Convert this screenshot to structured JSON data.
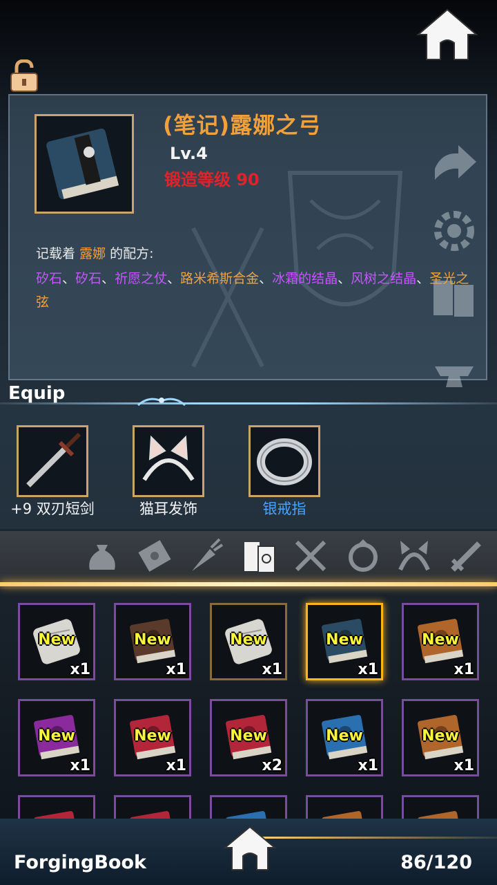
{
  "item": {
    "title": "(笔记)露娜之弓",
    "level": "Lv.4",
    "forge_label": "锻造等级",
    "forge_value": "90"
  },
  "recipe": {
    "prefix": "记载着",
    "name": "露娜",
    "suffix": "的配方:",
    "materials": [
      {
        "text": "矽石",
        "color": "purple"
      },
      {
        "text": "、",
        "color": "white"
      },
      {
        "text": "矽石",
        "color": "purple"
      },
      {
        "text": "、",
        "color": "white"
      },
      {
        "text": "祈愿之仗",
        "color": "purple"
      },
      {
        "text": "、",
        "color": "white"
      },
      {
        "text": "路米希斯合金",
        "color": "orange"
      },
      {
        "text": "、",
        "color": "white"
      },
      {
        "text": "冰霜的结晶",
        "color": "purple"
      },
      {
        "text": "、",
        "color": "white"
      },
      {
        "text": "风树之结晶",
        "color": "purple"
      },
      {
        "text": "、",
        "color": "white"
      },
      {
        "text": "圣光之弦",
        "color": "orange"
      }
    ]
  },
  "equip": {
    "title": "Equip",
    "slots": [
      {
        "label": "+9 双刃短剑",
        "icon": "dagger-icon",
        "color": "#f4f4f4"
      },
      {
        "label": "猫耳发饰",
        "icon": "cat-ear-headband-icon",
        "color": "#f4f4f4"
      },
      {
        "label": "银戒指",
        "icon": "silver-ring-icon",
        "color": "#4aa3ff"
      }
    ]
  },
  "categories": [
    {
      "name": "bag-icon",
      "active": false
    },
    {
      "name": "scroll-icon",
      "active": false
    },
    {
      "name": "carrot-icon",
      "active": false
    },
    {
      "name": "books-icon",
      "active": true
    },
    {
      "name": "utensils-icon",
      "active": false
    },
    {
      "name": "ring-icon",
      "active": false
    },
    {
      "name": "headband-icon",
      "active": false
    },
    {
      "name": "sword-icon",
      "active": false
    }
  ],
  "inventory": [
    {
      "new": "New",
      "qty": "x1",
      "kind": "scroll",
      "color": "#d8d6d0",
      "frame": "purple"
    },
    {
      "new": "New",
      "qty": "x1",
      "kind": "book",
      "color": "#5a3a2a",
      "frame": "purple"
    },
    {
      "new": "New",
      "qty": "x1",
      "kind": "scroll",
      "color": "#d8d6d0",
      "frame": "gold"
    },
    {
      "new": "New",
      "qty": "x1",
      "kind": "book",
      "color": "#2b4a63",
      "frame": "selected"
    },
    {
      "new": "New",
      "qty": "x1",
      "kind": "book",
      "color": "#b0652a",
      "frame": "purple"
    },
    {
      "new": "New",
      "qty": "x1",
      "kind": "book",
      "color": "#8b2a9c",
      "frame": "purple"
    },
    {
      "new": "New",
      "qty": "x1",
      "kind": "book",
      "color": "#b3263a",
      "frame": "purple"
    },
    {
      "new": "New",
      "qty": "x2",
      "kind": "book",
      "color": "#b3263a",
      "frame": "purple"
    },
    {
      "new": "New",
      "qty": "x1",
      "kind": "book",
      "color": "#2a6fb0",
      "frame": "purple"
    },
    {
      "new": "New",
      "qty": "x1",
      "kind": "book",
      "color": "#b0652a",
      "frame": "purple"
    },
    {
      "new": "",
      "qty": "",
      "kind": "book",
      "color": "#b3263a",
      "frame": "purple"
    },
    {
      "new": "",
      "qty": "",
      "kind": "book",
      "color": "#b3263a",
      "frame": "purple"
    },
    {
      "new": "",
      "qty": "",
      "kind": "book",
      "color": "#2a6fb0",
      "frame": "purple"
    },
    {
      "new": "",
      "qty": "",
      "kind": "book",
      "color": "#b0652a",
      "frame": "purple"
    },
    {
      "new": "",
      "qty": "",
      "kind": "book",
      "color": "#b0652a",
      "frame": "purple"
    }
  ],
  "footer": {
    "page_label": "ForgingBook",
    "count": "86/120"
  },
  "colors": {
    "title_orange": "#f2a13a",
    "forge_red": "#e0232b",
    "material_purple": "#c655ff",
    "new_yellow": "#f9f437",
    "selected_gold": "#ffb41a"
  }
}
